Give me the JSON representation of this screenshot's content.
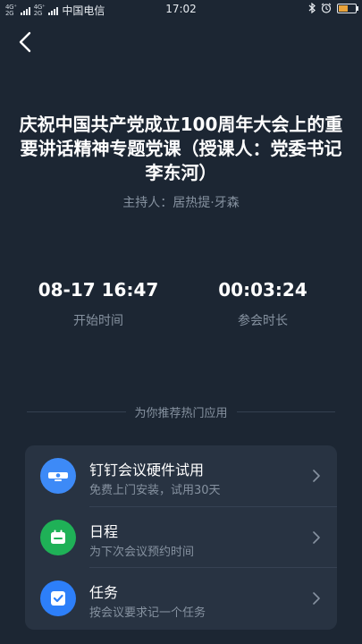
{
  "status_bar": {
    "network_left": "4G⁺ 4G⁺ 2G 2G",
    "carrier": "中国电信",
    "time": "17:02",
    "battery_level": 0.55,
    "icons": [
      "bluetooth-icon",
      "alarm-icon",
      "battery-icon"
    ]
  },
  "header": {
    "back_icon": "chevron-left-icon"
  },
  "meeting": {
    "title": "庆祝中国共产党成立100周年大会上的重要讲话精神专题党课（授课人：党委书记李东河）",
    "host": "主持人：居热提·牙森",
    "start_time_value": "08-17 16:47",
    "start_time_label": "开始时间",
    "duration_value": "00:03:24",
    "duration_label": "参会时长"
  },
  "recommend": {
    "heading": "为你推荐热门应用",
    "items": [
      {
        "title": "钉钉会议硬件试用",
        "subtitle": "免费上门安装，试用30天",
        "icon": "meeting-camera-icon",
        "color": "#3d8af7"
      },
      {
        "title": "日程",
        "subtitle": "为下次会议预约时间",
        "icon": "calendar-icon",
        "color": "#1fb157"
      },
      {
        "title": "任务",
        "subtitle": "按会议要求记一个任务",
        "icon": "task-check-icon",
        "color": "#2d7ff9"
      }
    ]
  }
}
